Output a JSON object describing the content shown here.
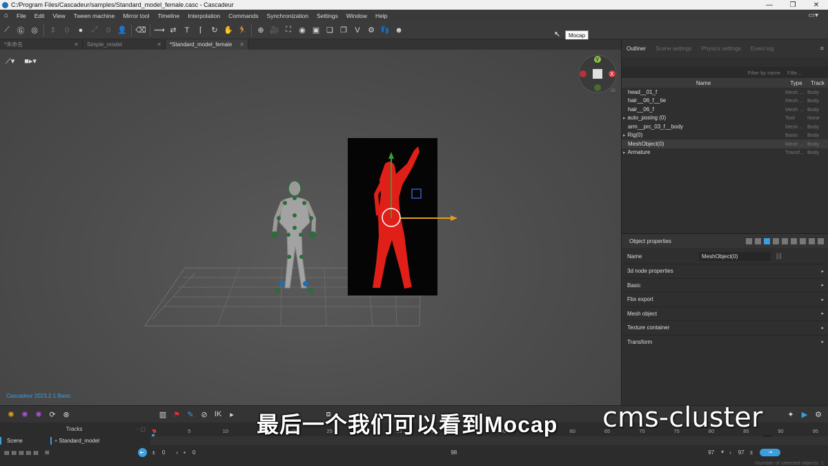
{
  "window": {
    "title": "C:/Program Files/Cascadeur/samples/Standard_model_female.casc - Cascadeur"
  },
  "menu": [
    "File",
    "Edit",
    "View",
    "Tween machine",
    "Mirror tool",
    "Timeline",
    "Interpolation",
    "Commands",
    "Synchronization",
    "Settings",
    "Window",
    "Help"
  ],
  "toolbar": {
    "tooltip": "Mocap",
    "field_a": "0",
    "field_b": "0"
  },
  "tabs": [
    {
      "label": "*未命名",
      "active": false
    },
    {
      "label": "Simple_model",
      "active": false
    },
    {
      "label": "*Standard_model_female",
      "active": true
    }
  ],
  "viewport": {
    "version": "Cascadeur 2023.2.1 Basic",
    "gizmo_y": "Y",
    "gizmo_x": "X",
    "gizmo_num": "33"
  },
  "outliner": {
    "tabs": [
      "Outliner",
      "Scene settings",
      "Physics settings",
      "Event log"
    ],
    "filter_placeholder": "Filter by name",
    "filter_type": "Filte...",
    "columns": {
      "name": "Name",
      "type": "Type",
      "track": "Track"
    },
    "rows": [
      {
        "name": "head__01_f",
        "type": "Mesh ...",
        "track": "Body",
        "expand": false
      },
      {
        "name": "hair__06_f__tie",
        "type": "Mesh ...",
        "track": "Body",
        "expand": false
      },
      {
        "name": "hair__06_f",
        "type": "Mesh ...",
        "track": "Body",
        "expand": false
      },
      {
        "name": "auto_posing (0)",
        "type": "Tool",
        "track": "None",
        "expand": true
      },
      {
        "name": "arm__prc_03_f__body",
        "type": "Mesh ...",
        "track": "Body",
        "expand": false
      },
      {
        "name": "Rig(0)",
        "type": "Basic",
        "track": "Body",
        "expand": true
      },
      {
        "name": "MeshObject(0)",
        "type": "Mesh ...",
        "track": "Body",
        "expand": false
      },
      {
        "name": "Armature",
        "type": "Transf...",
        "track": "Body",
        "expand": true
      }
    ]
  },
  "properties": {
    "title": "Object properties",
    "name_label": "Name",
    "name_value": "MeshObject(0)",
    "sections": [
      "3d node properties",
      "Basic",
      "Fbx export",
      "Mesh object",
      "Texture container",
      "Transform"
    ]
  },
  "timeline": {
    "tracks_label": "Tracks",
    "scene_label": "Scene",
    "model_label": "Standard_model",
    "ticks": [
      "0",
      "5",
      "10",
      "15",
      "20",
      "25",
      "30",
      "35",
      "40",
      "45",
      "50",
      "55",
      "60",
      "65",
      "70",
      "75",
      "80",
      "85",
      "90",
      "95"
    ],
    "current_frame": "90",
    "start": "0",
    "start2": "0",
    "length": "98",
    "end_a": "97",
    "end_b": "97",
    "status": "Number of selected objects: 1",
    "ik": "IK"
  },
  "overlay": {
    "subtitle": "最后一个我们可以看到Mocap",
    "watermark": "cms-cluster"
  },
  "colors": {
    "accent": "#3aa0e0",
    "mocap_red": "#e02018",
    "skeleton_green": "#2e6b3a"
  }
}
